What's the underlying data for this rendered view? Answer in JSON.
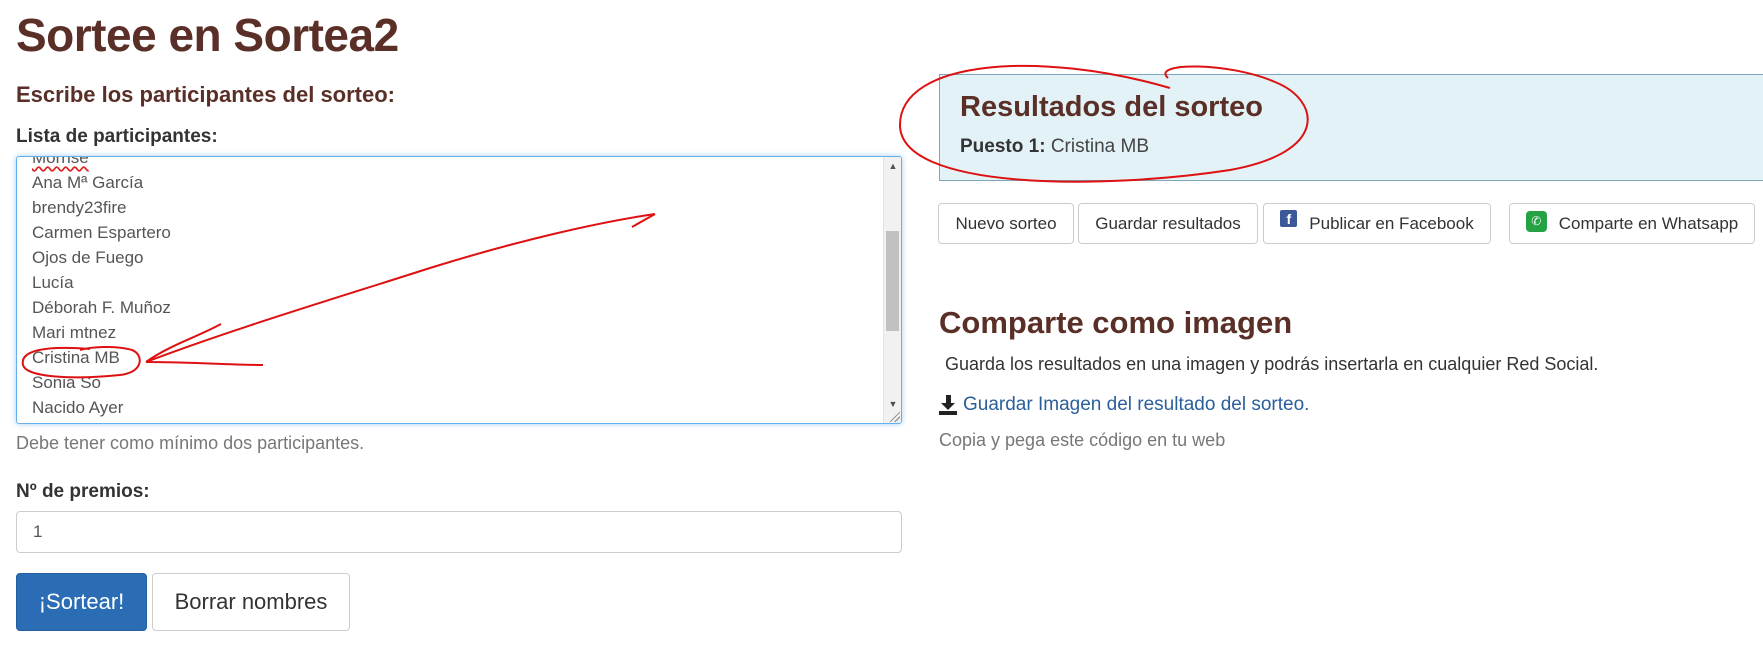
{
  "page": {
    "title": "Sortee en Sortea2",
    "section_heading": "Escribe los participantes del sorteo:"
  },
  "participants": {
    "label": "Lista de participantes:",
    "items": [
      "Morrise",
      "Ana Mª García",
      "brendy23fire",
      "Carmen Espartero",
      "Ojos de Fuego",
      "Lucía",
      "Déborah F. Muñoz",
      "Mari mtnez",
      "Cristina MB",
      "Sonia So",
      "Nacido Ayer"
    ],
    "help_text": "Debe tener como mínimo dos participantes."
  },
  "prizes": {
    "label": "Nº de premios:",
    "value": "1"
  },
  "buttons": {
    "draw": "¡Sortear!",
    "clear": "Borrar nombres"
  },
  "results": {
    "title": "Resultados del sorteo",
    "position_label": "Puesto 1:",
    "position_value": "Cristina MB"
  },
  "actions": {
    "new_draw": "Nuevo sorteo",
    "save_results": "Guardar resultados",
    "facebook": "Publicar en Facebook",
    "whatsapp": "Comparte en Whatsapp"
  },
  "share_image": {
    "title": "Comparte como imagen",
    "description": "Guarda los resultados en una imagen y podrás insertarla en cualquier Red Social.",
    "download_link": "Guardar Imagen del resultado del sorteo.",
    "embed_text": "Copia y pega este código en tu web"
  },
  "colors": {
    "heading": "#5a2f27",
    "primary_button": "#2a6db5",
    "results_panel": "#e3f2f7",
    "link": "#2a5f9a",
    "annotation": "#dd1111"
  }
}
